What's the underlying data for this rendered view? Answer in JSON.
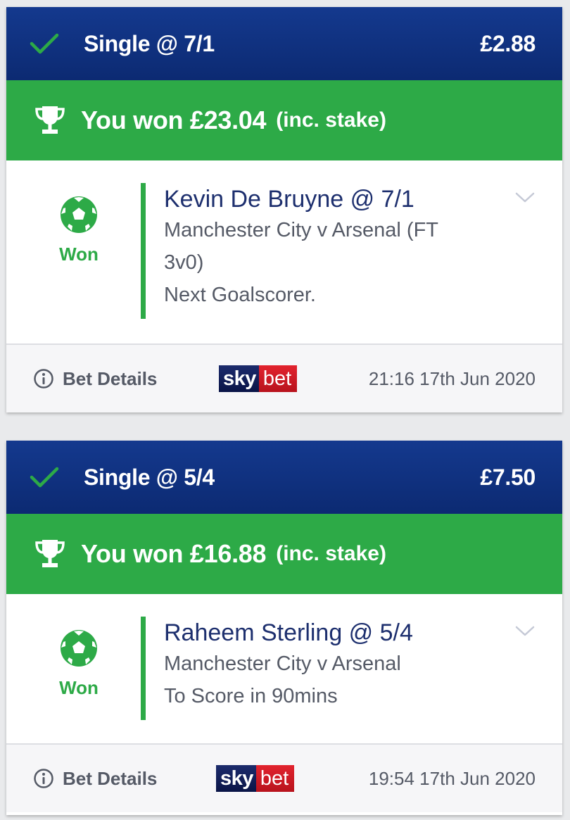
{
  "bets": [
    {
      "bet_type": "Single @ 7/1",
      "stake": "£2.88",
      "won_amount": "You won £23.04",
      "inc_stake": "(inc. stake)",
      "status": "Won",
      "selection_name": "Kevin De Bruyne @ 7/1",
      "details": [
        "Manchester City v Arsenal (FT",
        "3v0)",
        "Next Goalscorer."
      ],
      "bet_details_label": "Bet Details",
      "logo": {
        "sky": "sky",
        "bet": "bet"
      },
      "timestamp": "21:16 17th Jun 2020"
    },
    {
      "bet_type": "Single @ 5/4",
      "stake": "£7.50",
      "won_amount": "You won £16.88",
      "inc_stake": "(inc. stake)",
      "status": "Won",
      "selection_name": "Raheem Sterling @ 5/4",
      "details": [
        "Manchester City v Arsenal",
        "To Score in 90mins"
      ],
      "bet_details_label": "Bet Details",
      "logo": {
        "sky": "sky",
        "bet": "bet"
      },
      "timestamp": "19:54 17th Jun 2020"
    }
  ],
  "icons": {
    "status": "check-icon",
    "banner": "trophy-icon",
    "sport": "football-icon",
    "expand": "chevron-down-icon",
    "details": "info-icon"
  },
  "colors": {
    "header_blue": "#0c2a72",
    "won_green": "#2daa47",
    "selection_navy": "#1d2f6e",
    "sky_red": "#e2232e"
  }
}
